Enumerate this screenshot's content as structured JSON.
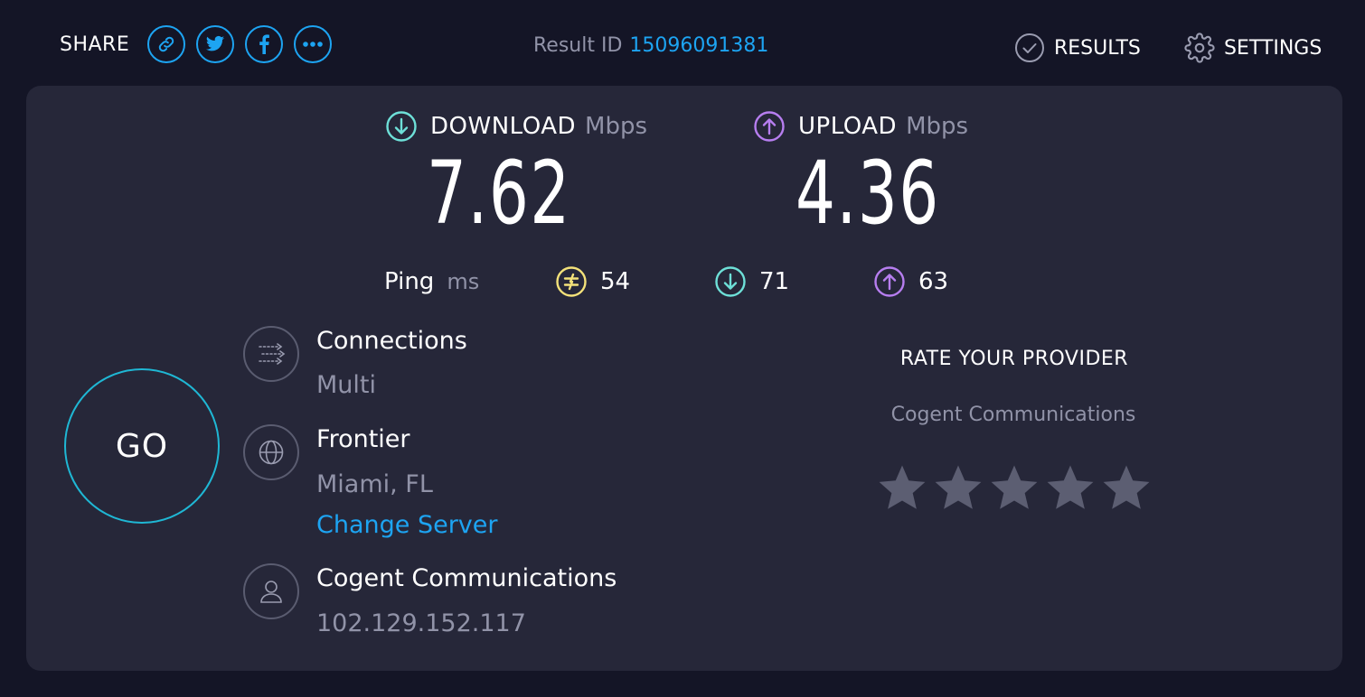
{
  "header": {
    "share_label": "SHARE",
    "share_buttons": [
      "link-icon",
      "twitter-icon",
      "facebook-icon",
      "more-icon"
    ],
    "result_id_label": "Result ID",
    "result_id_value": "15096091381",
    "results_label": "RESULTS",
    "settings_label": "SETTINGS"
  },
  "download": {
    "title": "DOWNLOAD",
    "unit": "Mbps",
    "value": "7.62"
  },
  "upload": {
    "title": "UPLOAD",
    "unit": "Mbps",
    "value": "4.36"
  },
  "ping": {
    "label": "Ping",
    "unit": "ms",
    "idle": "54",
    "download": "71",
    "upload": "63"
  },
  "go_label": "GO",
  "connections": {
    "title": "Connections",
    "value": "Multi"
  },
  "server": {
    "name": "Frontier",
    "location": "Miami, FL",
    "change_label": "Change Server"
  },
  "provider": {
    "name": "Cogent Communications",
    "ip": "102.129.152.117"
  },
  "rating": {
    "title": "RATE YOUR PROVIDER",
    "provider": "Cogent Communications",
    "stars": 5,
    "selected": 0
  },
  "colors": {
    "background": "#141526",
    "panel": "#262739",
    "accent_blue": "#1da4f2",
    "download_cyan": "#6ee0d8",
    "upload_purple": "#b77ef0",
    "ping_yellow": "#f4e27a",
    "muted": "#9193a8",
    "star": "#5c5e72"
  }
}
